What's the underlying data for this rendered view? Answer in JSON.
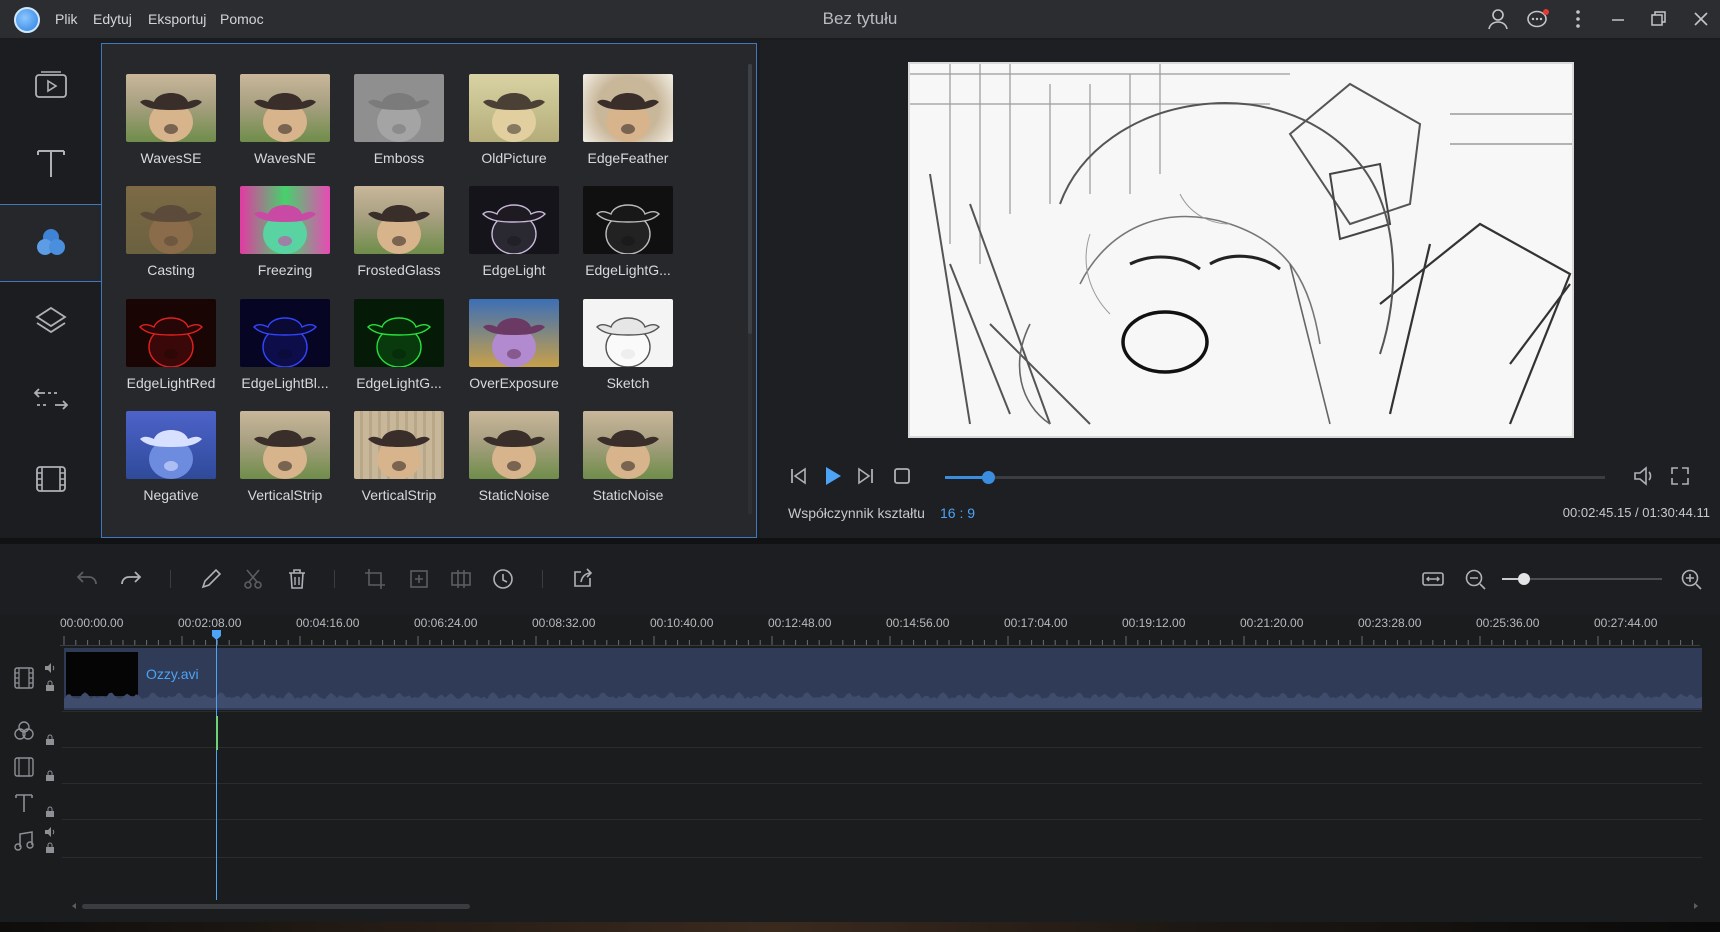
{
  "window": {
    "title": "Bez tytułu",
    "menu": [
      "Plik",
      "Edytuj",
      "Eksportuj",
      "Pomoc"
    ]
  },
  "colors": {
    "accent": "#3b8de0",
    "accent_text": "#4da3f5",
    "clip_bg": "#2f3b57"
  },
  "rail": {
    "items": [
      {
        "icon": "media-icon",
        "active": false
      },
      {
        "icon": "text-icon",
        "active": false
      },
      {
        "icon": "filters-icon",
        "active": true
      },
      {
        "icon": "overlay-icon",
        "active": false
      },
      {
        "icon": "transition-icon",
        "active": false
      },
      {
        "icon": "element-icon",
        "active": false
      }
    ]
  },
  "effects": [
    {
      "label": "WavesSE",
      "style": "normal"
    },
    {
      "label": "WavesNE",
      "style": "normal"
    },
    {
      "label": "Emboss",
      "style": "emboss"
    },
    {
      "label": "OldPicture",
      "style": "old"
    },
    {
      "label": "EdgeFeather",
      "style": "feather"
    },
    {
      "label": "Casting",
      "style": "casting"
    },
    {
      "label": "Freezing",
      "style": "freezing"
    },
    {
      "label": "FrostedGlass",
      "style": "normal"
    },
    {
      "label": "EdgeLight",
      "style": "edge"
    },
    {
      "label": "EdgeLightG...",
      "style": "edgegray"
    },
    {
      "label": "EdgeLightRed",
      "style": "red"
    },
    {
      "label": "EdgeLightBl...",
      "style": "blue"
    },
    {
      "label": "EdgeLightG...",
      "style": "green"
    },
    {
      "label": "OverExposure",
      "style": "overexp"
    },
    {
      "label": "Sketch",
      "style": "sketch"
    },
    {
      "label": "Negative",
      "style": "negative"
    },
    {
      "label": "VerticalStrip",
      "style": "normal"
    },
    {
      "label": "VerticalStrip",
      "style": "strip"
    },
    {
      "label": "StaticNoise",
      "style": "normal"
    },
    {
      "label": "StaticNoise",
      "style": "normal"
    }
  ],
  "player": {
    "progress": 0.035,
    "aspect_label": "Współczynnik kształtu",
    "aspect_value": "16 : 9",
    "time": "00:02:45.15 / 01:30:44.11"
  },
  "timeline": {
    "zoom_level": 0.14,
    "ruler": [
      "00:00:00.00",
      "00:02:08.00",
      "00:04:16.00",
      "00:06:24.00",
      "00:08:32.00",
      "00:10:40.00",
      "00:12:48.00",
      "00:14:56.00",
      "00:17:04.00",
      "00:19:12.00",
      "00:21:20.00",
      "00:23:28.00",
      "00:25:36.00",
      "00:27:44.00"
    ],
    "clip_name": "Ozzy.avi",
    "playhead_time": "00:02:08.00"
  }
}
